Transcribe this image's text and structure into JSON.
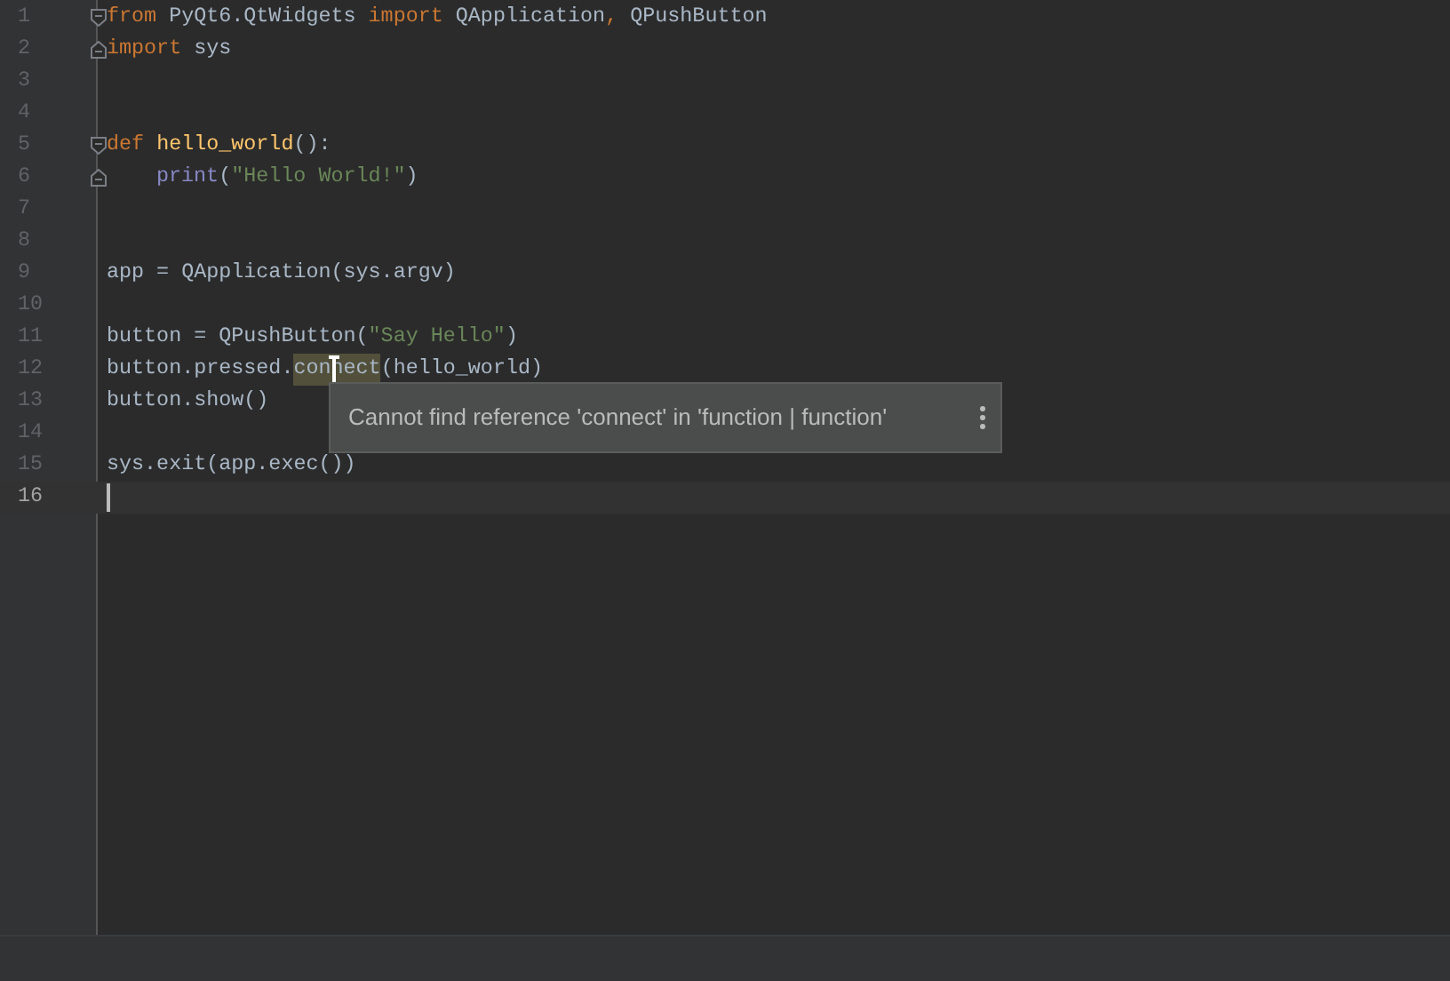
{
  "editor": {
    "lines": [
      {
        "number": "1",
        "kind": "fold_start",
        "current": false,
        "tokens": [
          {
            "kind": "keyword",
            "text": "from "
          },
          {
            "kind": "plain",
            "text": "PyQt6.QtWidgets "
          },
          {
            "kind": "keyword",
            "text": "import "
          },
          {
            "kind": "plain",
            "text": "QApplication"
          },
          {
            "kind": "keyword",
            "text": ", "
          },
          {
            "kind": "plain",
            "text": "QPushButton"
          }
        ]
      },
      {
        "number": "2",
        "kind": "fold_end",
        "current": false,
        "tokens": [
          {
            "kind": "keyword",
            "text": "import "
          },
          {
            "kind": "plain",
            "text": "sys"
          }
        ]
      },
      {
        "number": "3",
        "kind": "plain",
        "current": false
      },
      {
        "number": "4",
        "kind": "plain",
        "current": false
      },
      {
        "number": "5",
        "kind": "fold_start",
        "current": false,
        "tokens": [
          {
            "kind": "keyword",
            "text": "def "
          },
          {
            "kind": "function",
            "text": "hello_world"
          },
          {
            "kind": "plain",
            "text": "():"
          }
        ]
      },
      {
        "number": "6",
        "kind": "fold_end",
        "current": false,
        "indented": true,
        "tokens": [
          {
            "kind": "builtin",
            "text": "print"
          },
          {
            "kind": "plain",
            "text": "("
          },
          {
            "kind": "string",
            "text": "\"Hello World!\""
          },
          {
            "kind": "plain",
            "text": ")"
          }
        ]
      },
      {
        "number": "7",
        "kind": "plain",
        "current": false
      },
      {
        "number": "8",
        "kind": "plain",
        "current": false
      },
      {
        "number": "9",
        "kind": "plain",
        "current": false,
        "tokens": [
          {
            "kind": "plain",
            "text": "app = QApplication(sys.argv)"
          }
        ]
      },
      {
        "number": "10",
        "kind": "plain",
        "current": false
      },
      {
        "number": "11",
        "kind": "plain",
        "current": false,
        "tokens": [
          {
            "kind": "plain",
            "text": "button = QPushButton("
          },
          {
            "kind": "string",
            "text": "\"Say Hello\""
          },
          {
            "kind": "plain",
            "text": ")"
          }
        ]
      },
      {
        "number": "12",
        "kind": "plain",
        "current": false,
        "tokens": [
          {
            "kind": "plain",
            "text": "button.pressed."
          },
          {
            "kind": "warning",
            "text": "connect"
          },
          {
            "kind": "plain",
            "text": "(hello_world)"
          }
        ]
      },
      {
        "number": "13",
        "kind": "plain",
        "current": false,
        "tokens": [
          {
            "kind": "plain",
            "text": "button.show()"
          }
        ]
      },
      {
        "number": "14",
        "kind": "plain",
        "current": false
      },
      {
        "number": "15",
        "kind": "plain",
        "current": false,
        "tokens": [
          {
            "kind": "plain",
            "text": "sys.exit(app.exec())"
          }
        ]
      },
      {
        "number": "16",
        "kind": "plain",
        "current": true
      }
    ]
  },
  "tooltip": {
    "message": "Cannot find reference 'connect' in 'function | function'"
  }
}
